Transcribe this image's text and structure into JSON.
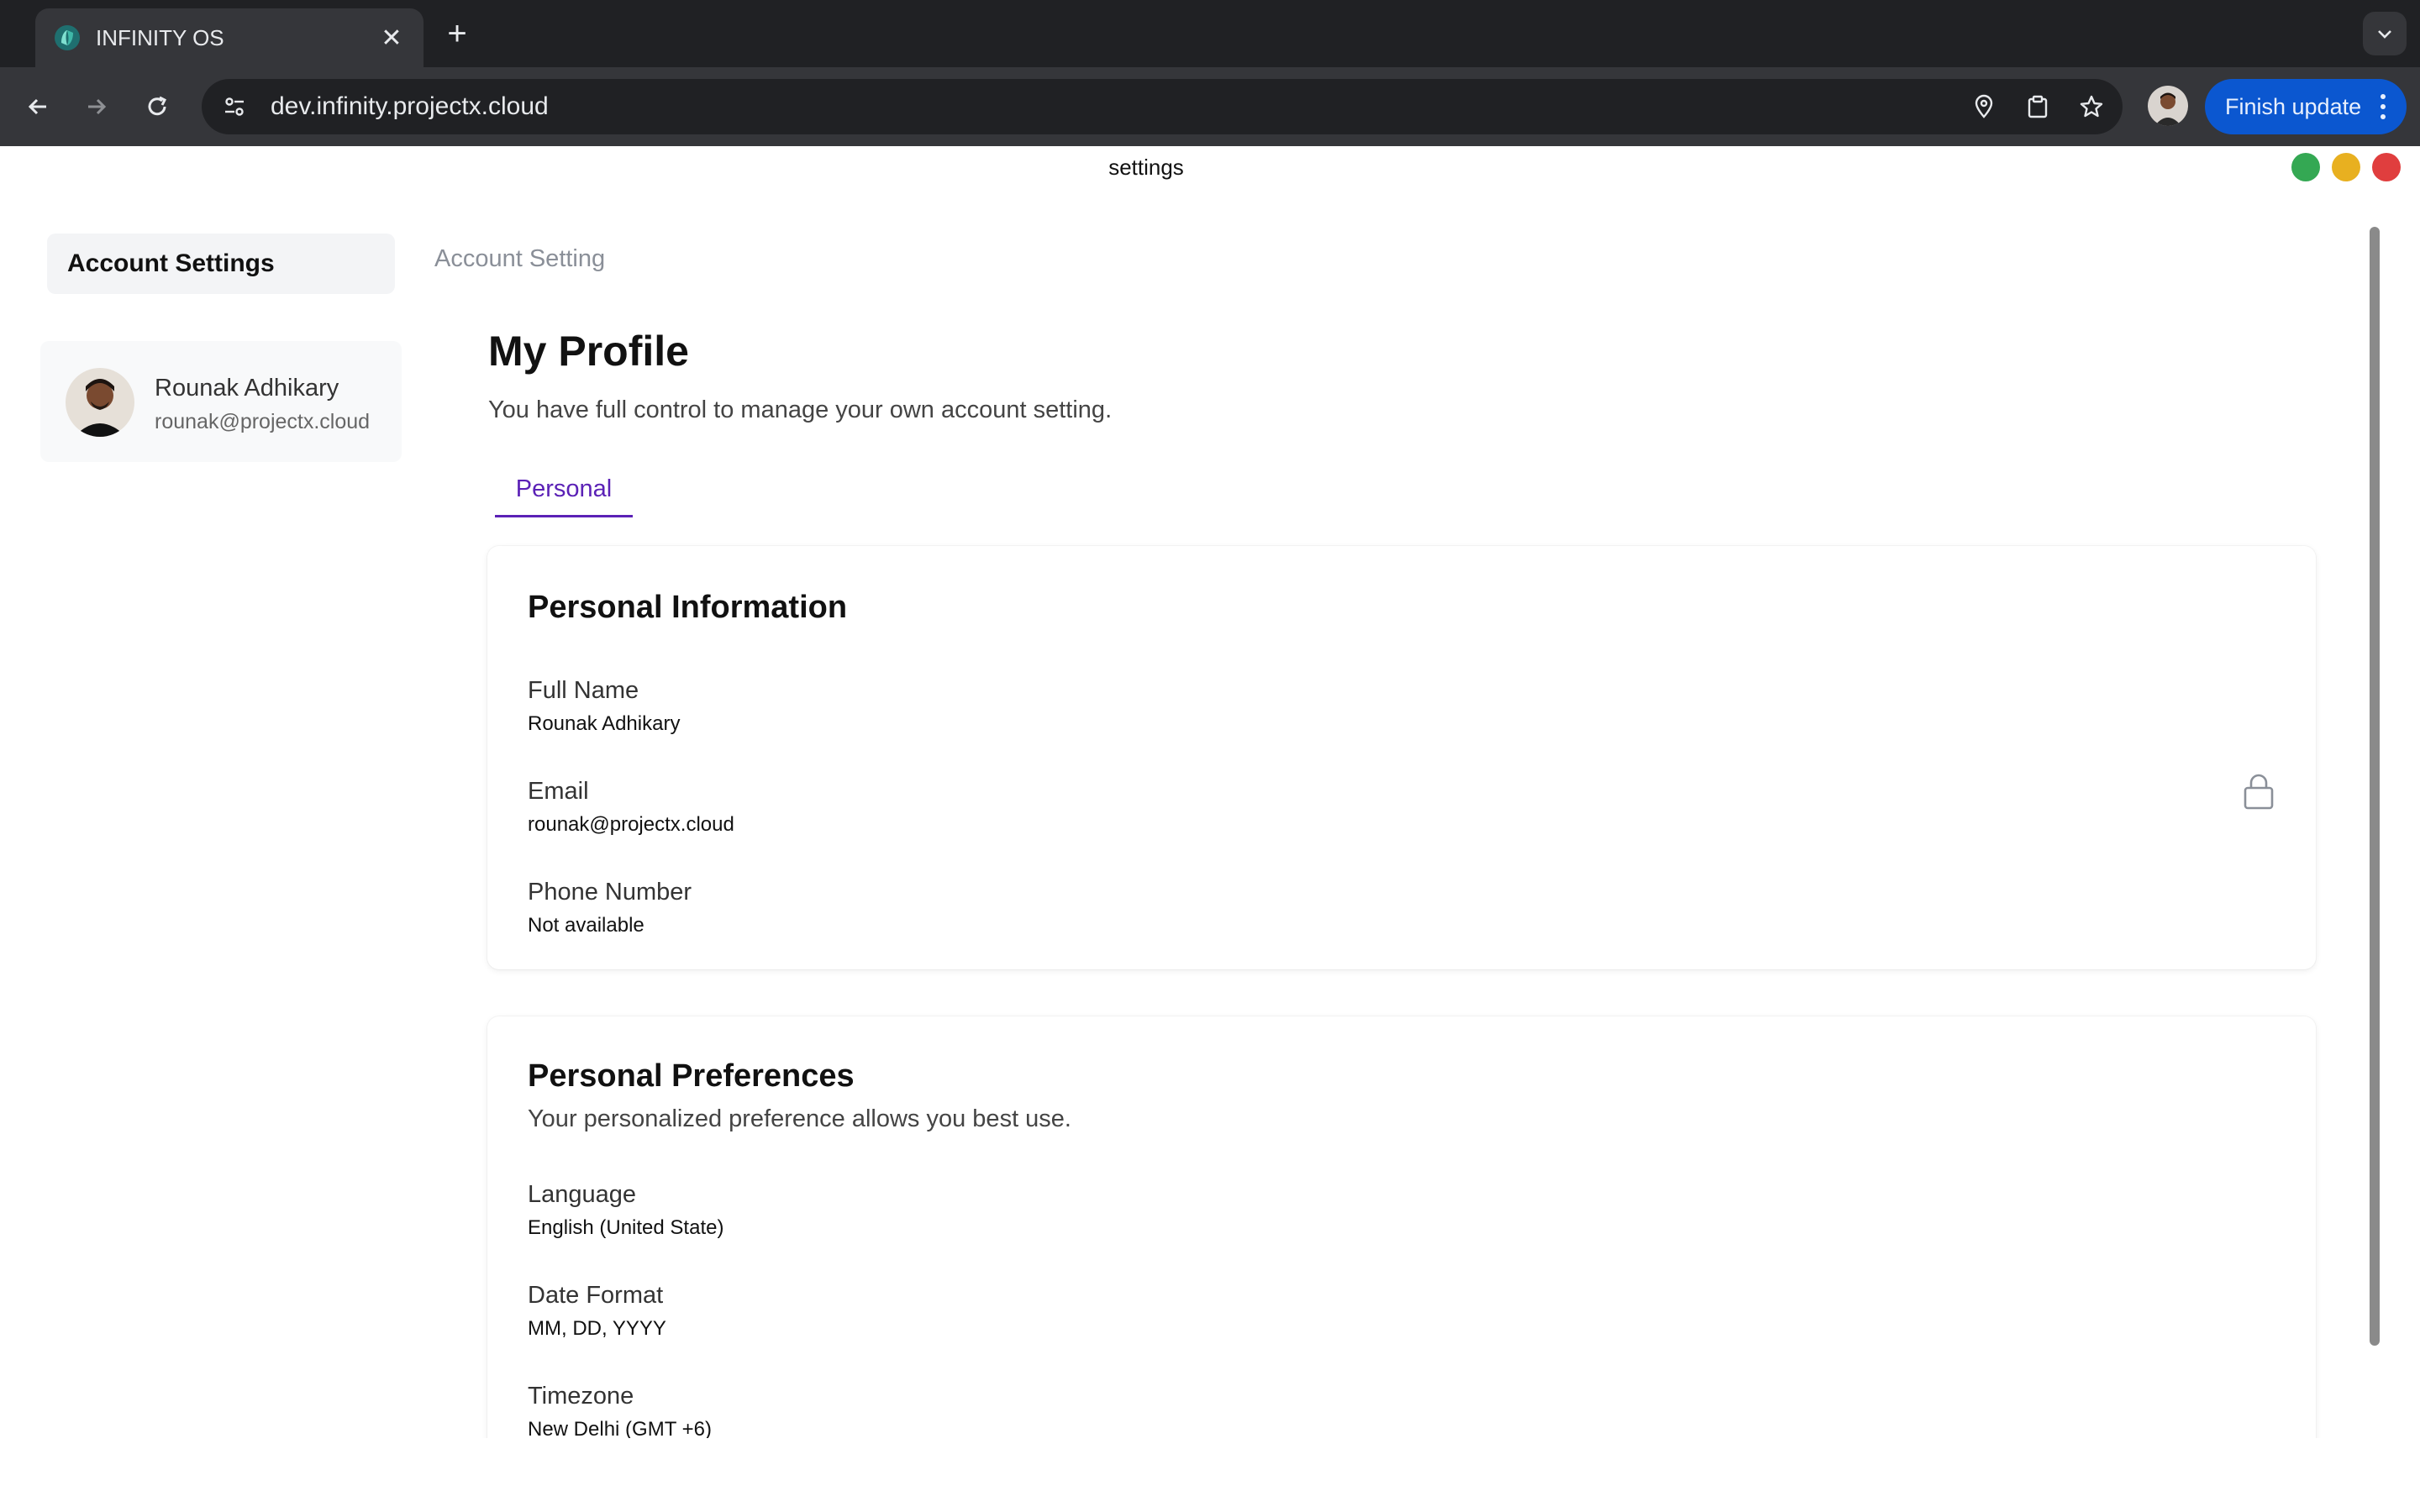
{
  "browser": {
    "tab_title": "INFINITY OS",
    "url": "dev.infinity.projectx.cloud",
    "finish_update_label": "Finish update"
  },
  "window": {
    "title": "settings",
    "controls": {
      "green": "#34a853",
      "yellow": "#e8b020",
      "red": "#e03e3e"
    }
  },
  "sidebar": {
    "header": "Account Settings",
    "user": {
      "name": "Rounak Adhikary",
      "email": "rounak@projectx.cloud"
    }
  },
  "main": {
    "breadcrumb": "Account Setting",
    "title": "My Profile",
    "subtitle": "You have full control to manage your own account setting.",
    "tabs": [
      {
        "label": "Personal",
        "active": true
      }
    ],
    "personal_info": {
      "title": "Personal Information",
      "fields": [
        {
          "label": "Full Name",
          "value": "Rounak Adhikary"
        },
        {
          "label": "Email",
          "value": "rounak@projectx.cloud",
          "icon": "lock-icon"
        },
        {
          "label": "Phone Number",
          "value": "Not available"
        }
      ]
    },
    "preferences": {
      "title": "Personal Preferences",
      "subtitle": "Your personalized preference allows you best use.",
      "fields": [
        {
          "label": "Language",
          "value": "English (United State)"
        },
        {
          "label": "Date Format",
          "value": "MM, DD, YYYY"
        },
        {
          "label": "Timezone",
          "value": "New Delhi (GMT +6)"
        }
      ]
    }
  },
  "colors": {
    "accent": "#5b21b6",
    "update_button": "#0b57d0",
    "chrome_dark": "#202124",
    "chrome_toolbar": "#35363a"
  }
}
